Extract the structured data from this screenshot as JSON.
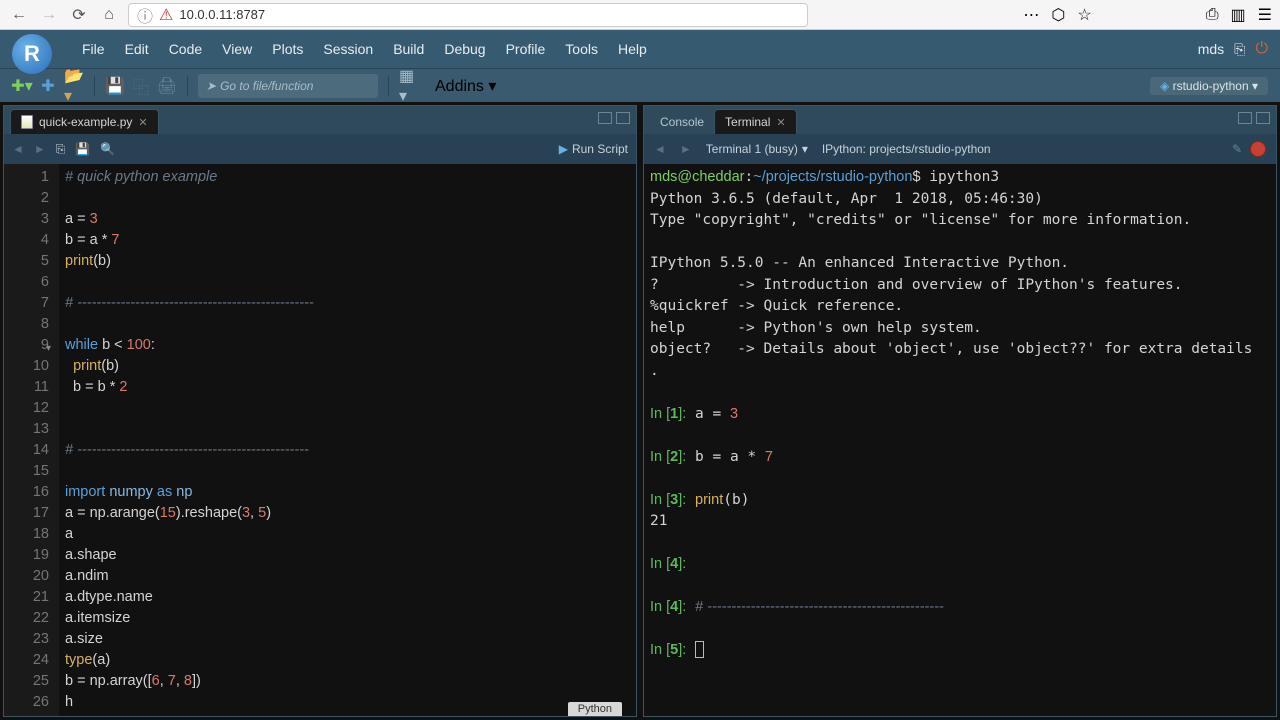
{
  "browser": {
    "url": "10.0.0.11:8787"
  },
  "menubar": {
    "items": [
      "File",
      "Edit",
      "Code",
      "View",
      "Plots",
      "Session",
      "Build",
      "Debug",
      "Profile",
      "Tools",
      "Help"
    ],
    "user": "mds"
  },
  "toolbar": {
    "goto_placeholder": "Go to file/function",
    "addins_label": "Addins",
    "project_label": "rstudio-python"
  },
  "editor": {
    "tab_title": "quick-example.py",
    "run_label": "Run Script",
    "footer": "Python",
    "lines": [
      {
        "n": 1,
        "html": "<span class='c-comment'># quick python example</span>"
      },
      {
        "n": 2,
        "html": ""
      },
      {
        "n": 3,
        "html": "<span class='c-id'>a</span> = <span class='c-num'>3</span>"
      },
      {
        "n": 4,
        "html": "<span class='c-id'>b</span> = a * <span class='c-num'>7</span>"
      },
      {
        "n": 5,
        "html": "<span class='c-fn'>print</span>(b)"
      },
      {
        "n": 6,
        "html": ""
      },
      {
        "n": 7,
        "html": "<span class='c-comment'># -------------------------------------------------</span>"
      },
      {
        "n": 8,
        "html": ""
      },
      {
        "n": 9,
        "html": "<span class='c-kw'>while</span> b &lt; <span class='c-num'>100</span>:"
      },
      {
        "n": 10,
        "html": "  <span class='c-fn'>print</span>(b)"
      },
      {
        "n": 11,
        "html": "  b = b * <span class='c-num'>2</span>"
      },
      {
        "n": 12,
        "html": ""
      },
      {
        "n": 13,
        "html": ""
      },
      {
        "n": 14,
        "html": "<span class='c-comment'># ------------------------------------------------</span>"
      },
      {
        "n": 15,
        "html": ""
      },
      {
        "n": 16,
        "html": "<span class='c-kw'>import</span> <span class='c-kw2'>numpy</span> <span class='c-kw'>as</span> <span class='c-kw2'>np</span>"
      },
      {
        "n": 17,
        "html": "a = np.arange(<span class='c-num'>15</span>).reshape(<span class='c-num'>3</span>, <span class='c-num'>5</span>)"
      },
      {
        "n": 18,
        "html": "a"
      },
      {
        "n": 19,
        "html": "a.shape"
      },
      {
        "n": 20,
        "html": "a.ndim"
      },
      {
        "n": 21,
        "html": "a.dtype.name"
      },
      {
        "n": 22,
        "html": "a.itemsize"
      },
      {
        "n": 23,
        "html": "a.size"
      },
      {
        "n": 24,
        "html": "<span class='c-fn'>type</span>(a)"
      },
      {
        "n": 25,
        "html": "b = np.array([<span class='c-num'>6</span>, <span class='c-num'>7</span>, <span class='c-num'>8</span>])"
      },
      {
        "n": 26,
        "html": "h"
      }
    ]
  },
  "right_tabs": {
    "console": "Console",
    "terminal": "Terminal"
  },
  "term_toolbar": {
    "name": "Terminal 1 (busy)",
    "title": "IPython: projects/rstudio-python"
  },
  "terminal": {
    "prompt_user": "mds@cheddar",
    "prompt_path": "~/projects/rstudio-python",
    "prompt_cmd": "ipython3",
    "startup": [
      "Python 3.6.5 (default, Apr  1 2018, 05:46:30)",
      "Type \"copyright\", \"credits\" or \"license\" for more information.",
      "",
      "IPython 5.5.0 -- An enhanced Interactive Python.",
      "?         -> Introduction and overview of IPython's features.",
      "%quickref -> Quick reference.",
      "help      -> Python's own help system.",
      "object?   -> Details about 'object', use 'object??' for extra details",
      "."
    ],
    "cells": [
      {
        "n": 1,
        "in": "a = <span class='c-num'>3</span>",
        "out": ""
      },
      {
        "n": 2,
        "in": "b = a * <span class='c-num'>7</span>",
        "out": ""
      },
      {
        "n": 3,
        "in": "<span class='c-fn'>print</span>(b)",
        "out": "21"
      },
      {
        "n": 4,
        "in": "",
        "out": ""
      },
      {
        "n": 4,
        "in": "<span class='c-comment'># -------------------------------------------------</span>",
        "out": "",
        "repeat": true
      },
      {
        "n": 5,
        "in": "<span class='cursor'></span>",
        "out": ""
      }
    ]
  }
}
